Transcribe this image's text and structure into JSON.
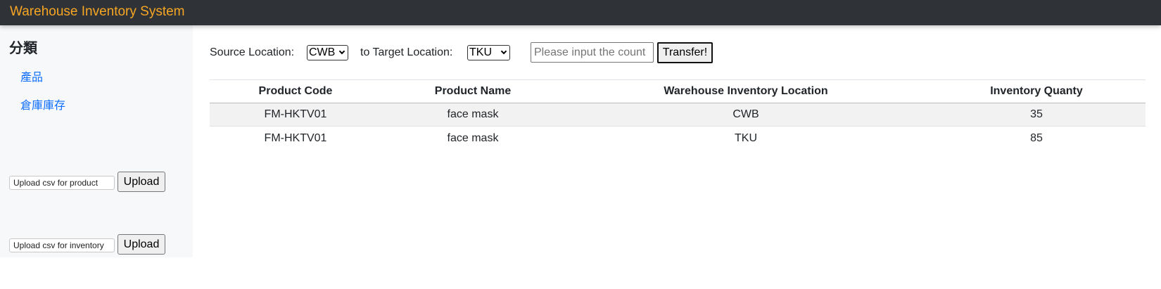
{
  "app": {
    "title": "Warehouse Inventory System",
    "brand_color": "#f6a623"
  },
  "sidebar": {
    "heading": "分類",
    "links": [
      {
        "label": "產品"
      },
      {
        "label": "倉庫庫存"
      }
    ],
    "uploads": [
      {
        "file_label": "Upload csv for product",
        "button": "Upload"
      },
      {
        "file_label": "Upload csv for inventory",
        "button": "Upload"
      }
    ]
  },
  "transfer": {
    "source_label": "Source Location:",
    "source_value": "CWB",
    "target_label": "to Target Location:",
    "target_value": "TKU",
    "count_placeholder": "Please input the count",
    "button": "Transfer!"
  },
  "table": {
    "headers": [
      "Product Code",
      "Product Name",
      "Warehouse Inventory Location",
      "Inventory Quanty"
    ],
    "rows": [
      [
        "FM-HKTV01",
        "face mask",
        "CWB",
        "35"
      ],
      [
        "FM-HKTV01",
        "face mask",
        "TKU",
        "85"
      ]
    ]
  }
}
